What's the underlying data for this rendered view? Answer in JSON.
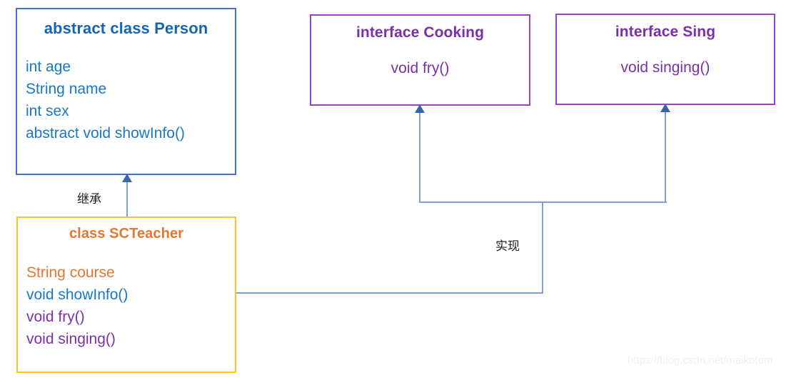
{
  "diagram": {
    "kind": "uml-class-diagram",
    "colors": {
      "class_blue_border": "#4472C4",
      "class_blue_title": "#1665B0",
      "class_blue_member": "#1878C8",
      "class_orange_border": "#FFC424",
      "class_orange_title": "#E8762C",
      "interface_purple_border": "#9A41C4",
      "interface_purple_text": "#7B2FAC",
      "connector_line": "#7FA0D8",
      "connector_arrow": "#3A64AE",
      "label_text": "#222222",
      "watermark": "#F0F0F0",
      "background": "#FFFFFF"
    },
    "boxes": [
      {
        "id": "person",
        "title": "abstract class Person",
        "members": [
          {
            "text": "int age",
            "color_role": "blue"
          },
          {
            "text": "String name",
            "color_role": "blue"
          },
          {
            "text": "int sex",
            "color_role": "blue"
          },
          {
            "text": "abstract void showInfo()",
            "color_role": "blue"
          }
        ]
      },
      {
        "id": "scteacher",
        "title": "class SCTeacher",
        "members": [
          {
            "text": "String course",
            "color_role": "orange"
          },
          {
            "text": "void showInfo()",
            "color_role": "blue"
          },
          {
            "text": "void fry()",
            "color_role": "purple"
          },
          {
            "text": "void singing()",
            "color_role": "purple"
          }
        ]
      },
      {
        "id": "cooking",
        "title": "interface Cooking",
        "members": [
          {
            "text": "void fry()",
            "color_role": "purple"
          }
        ]
      },
      {
        "id": "sing",
        "title": "interface Sing",
        "members": [
          {
            "text": "void singing()",
            "color_role": "purple"
          }
        ]
      }
    ],
    "connectors": [
      {
        "id": "inheritance",
        "label": "继承",
        "from": "scteacher",
        "to": "person",
        "arrow": "up"
      },
      {
        "id": "realization",
        "label": "实现",
        "from": "scteacher",
        "to": "cooking, sing",
        "arrow": "up"
      }
    ],
    "watermark": "https://blog.csdn.net/maikotom"
  }
}
